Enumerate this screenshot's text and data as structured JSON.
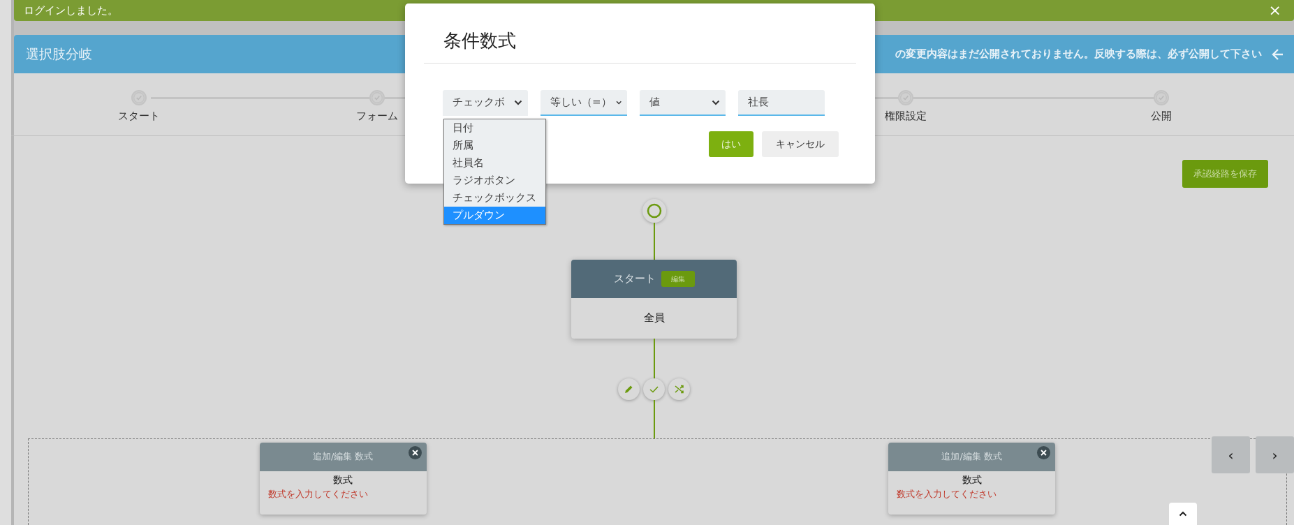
{
  "banner": {
    "message": "ログインしました。",
    "close": "×"
  },
  "panel": {
    "title": "選択肢分岐",
    "notice": "の変更内容はまだ公開されておりません。反映する際は、必ず公開して下さい"
  },
  "steps": [
    {
      "label": "スタート"
    },
    {
      "label": "フォーム"
    },
    {
      "label": "権限設定"
    },
    {
      "label": "公開"
    }
  ],
  "save_button": "承認経路を保存",
  "start_node": {
    "title": "スタート",
    "edit": "編集",
    "body": "全員"
  },
  "branches": [
    {
      "title": "追加/編集 数式",
      "heading": "数式",
      "error": "数式を入力してください"
    },
    {
      "title": "追加/編集 数式",
      "heading": "数式",
      "error": "数式を入力してください"
    }
  ],
  "pager": [
    "‹",
    "›"
  ],
  "modal": {
    "title": "条件数式",
    "selects": [
      {
        "value": "チェックボ",
        "open": true
      },
      {
        "value": "等しい（=）",
        "open": false
      },
      {
        "value": "値",
        "open": false
      }
    ],
    "input": {
      "value": "社長"
    },
    "options": [
      {
        "label": "日付",
        "selected": false
      },
      {
        "label": "所属",
        "selected": false
      },
      {
        "label": "社員名",
        "selected": false
      },
      {
        "label": "ラジオボタン",
        "selected": false
      },
      {
        "label": "チェックボックス",
        "selected": false
      },
      {
        "label": "プルダウン",
        "selected": true
      }
    ],
    "ok": "はい",
    "cancel": "キャンセル"
  }
}
